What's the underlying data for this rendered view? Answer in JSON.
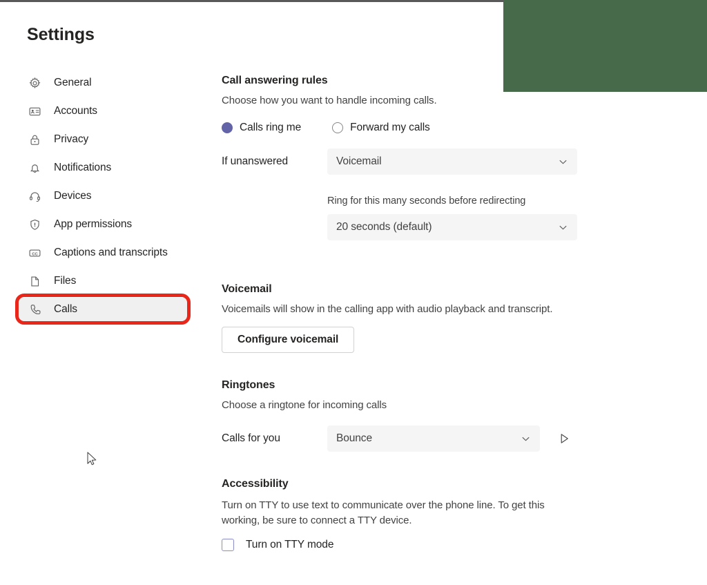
{
  "window": {
    "title": "Settings",
    "accent_color": "#6264a7",
    "annotation_color": "#e8271a",
    "overlay_block_color": "#476b4a"
  },
  "sidebar": {
    "items": [
      {
        "label": "General",
        "icon": "gear-icon",
        "selected": false
      },
      {
        "label": "Accounts",
        "icon": "contact-card-icon",
        "selected": false
      },
      {
        "label": "Privacy",
        "icon": "lock-icon",
        "selected": false
      },
      {
        "label": "Notifications",
        "icon": "bell-icon",
        "selected": false
      },
      {
        "label": "Devices",
        "icon": "headset-icon",
        "selected": false
      },
      {
        "label": "App permissions",
        "icon": "shield-icon",
        "selected": false
      },
      {
        "label": "Captions and transcripts",
        "icon": "closed-caption-icon",
        "selected": false
      },
      {
        "label": "Files",
        "icon": "file-icon",
        "selected": false
      },
      {
        "label": "Calls",
        "icon": "phone-icon",
        "selected": true
      }
    ]
  },
  "call_answering_rules": {
    "title": "Call answering rules",
    "description": "Choose how you want to handle incoming calls.",
    "radio_ring_me": "Calls ring me",
    "radio_forward": "Forward my calls",
    "selected_option": "Calls ring me",
    "if_unanswered_label": "If unanswered",
    "if_unanswered_value": "Voicemail",
    "ring_seconds_label": "Ring for this many seconds before redirecting",
    "ring_seconds_value": "20 seconds (default)"
  },
  "voicemail": {
    "title": "Voicemail",
    "description": "Voicemails will show in the calling app with audio playback and transcript.",
    "configure_button": "Configure voicemail"
  },
  "ringtones": {
    "title": "Ringtones",
    "description": "Choose a ringtone for incoming calls",
    "calls_for_you_label": "Calls for you",
    "calls_for_you_value": "Bounce",
    "preview_icon": "play-icon"
  },
  "accessibility": {
    "title": "Accessibility",
    "description": "Turn on TTY to use text to communicate over the phone line. To get this working, be sure to connect a TTY device.",
    "tty_label": "Turn on TTY mode",
    "tty_checked": false
  }
}
